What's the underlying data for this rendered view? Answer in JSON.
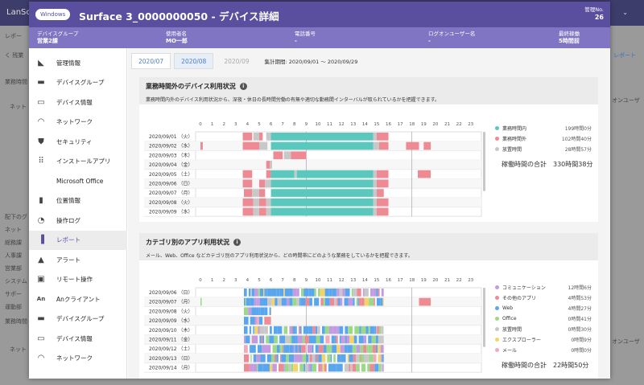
{
  "background": {
    "app_title": "LanSc",
    "left_labels": [
      "レポー",
      "く 残業",
      "業務時間",
      "ネット",
      "配下のグ",
      "ネット",
      "総務課",
      "人事課",
      "営業部",
      "システム",
      "サポー",
      "運動部",
      "業務時間",
      "ネット"
    ],
    "right_labels": [
      "レポート",
      "オンユーザ",
      "オンユーザ"
    ]
  },
  "modal": {
    "os_badge": "Windows",
    "title": "Surface 3_0000000050 - デバイス詳細",
    "mgmt_label": "管理No.",
    "mgmt_value": "26",
    "info": [
      {
        "label": "デバイスグループ",
        "value": "営業2課"
      },
      {
        "label": "使用者名",
        "value": "MO一郎"
      },
      {
        "label": "電話番号",
        "value": "-"
      },
      {
        "label": "ログオンユーザー名",
        "value": "-"
      },
      {
        "label": "最終稼働",
        "value": "5時間前"
      }
    ]
  },
  "sidebar": {
    "items": [
      {
        "label": "管理情報",
        "icon": "tag-icon"
      },
      {
        "label": "デバイスグループ",
        "icon": "folder-icon"
      },
      {
        "label": "デバイス情報",
        "icon": "device-icon"
      },
      {
        "label": "ネットワーク",
        "icon": "wifi-icon"
      },
      {
        "label": "セキュリティ",
        "icon": "shield-icon"
      },
      {
        "label": "インストールアプリ",
        "icon": "apps-grid-icon"
      },
      {
        "label": "Microsoft Office",
        "icon": "office-icon"
      },
      {
        "label": "位置情報",
        "icon": "map-icon"
      },
      {
        "label": "操作ログ",
        "icon": "history-icon"
      },
      {
        "label": "レポート",
        "icon": "bar-chart-icon",
        "active": true
      },
      {
        "label": "アラート",
        "icon": "warning-icon"
      },
      {
        "label": "リモート操作",
        "icon": "remote-icon"
      },
      {
        "label": "Anクライアント",
        "icon": "an-client-icon"
      },
      {
        "label": "デバイスグループ",
        "icon": "folder-icon"
      },
      {
        "label": "デバイス情報",
        "icon": "device-icon"
      },
      {
        "label": "ネットワーク",
        "icon": "wifi-icon"
      }
    ]
  },
  "tabs": {
    "items": [
      "2020/07",
      "2020/08",
      "2020/09"
    ],
    "selected": 1,
    "period": "集計期間: 2020/09/01 ～ 2020/09/29"
  },
  "card1": {
    "title": "業務時間外のデバイス利用状況",
    "desc": "業務時間内外のデバイス利用状況から、深夜・休日の長時間労働の有無や適切な勤務間インターバルが取られているかを把握できます。",
    "legend": [
      {
        "name": "業務時間内",
        "value": "199時間0分",
        "color": "#5bc8bd"
      },
      {
        "name": "業務時間外",
        "value": "102時間40分",
        "color": "#ee8a94"
      },
      {
        "name": "放置時間",
        "value": "28時間57分",
        "color": "#c8c8c8"
      }
    ],
    "total_label": "稼働時間の合計",
    "total_value": "330時間38分"
  },
  "card2": {
    "title": "カテゴリ別のアプリ利用状況",
    "desc": "メール、Web、Office などカテゴリ別のアプリ利用状況から、どの時間帯にどのような業務をしているかを把握できます。",
    "legend": [
      {
        "name": "コミュニケーション",
        "value": "12時間6分",
        "color": "#c39be0"
      },
      {
        "name": "その他のアプリ",
        "value": "4時間53分",
        "color": "#ee8a94"
      },
      {
        "name": "Web",
        "value": "4時間27分",
        "color": "#5aa6ee"
      },
      {
        "name": "Office",
        "value": "0時間41分",
        "color": "#9bd88a"
      },
      {
        "name": "放置時間",
        "value": "0時間30分",
        "color": "#c8c8c8"
      },
      {
        "name": "エクスプローラー",
        "value": "0時間9分",
        "color": "#f3d46a"
      },
      {
        "name": "メール",
        "value": "0時間0分",
        "color": "#f4a9b8"
      }
    ],
    "total_label": "稼働時間の合計",
    "total_value": "22時間50分"
  },
  "chart_data": [
    {
      "type": "timeline",
      "title": "業務時間外のデバイス利用状況",
      "hours": [
        "0",
        "1",
        "2",
        "3",
        "4",
        "5",
        "6",
        "7",
        "8",
        "9",
        "10",
        "11",
        "12",
        "13",
        "14",
        "15",
        "16",
        "17",
        "18",
        "19",
        "20",
        "21",
        "22",
        "23"
      ],
      "rows": [
        {
          "label": "2020/09/01 （火）",
          "segments": [
            [
              13.6,
              14.4,
              "out"
            ],
            [
              14.5,
              15.0,
              "idle"
            ],
            [
              15.0,
              15.3,
              "out"
            ],
            [
              15.6,
              16.0,
              "idle"
            ],
            [
              16.0,
              24.7,
              "in"
            ],
            [
              24.7,
              25.0,
              "idle"
            ],
            [
              25.0,
              26.0,
              "out"
            ]
          ]
        },
        {
          "label": "2020/09/02 （水）",
          "segments": [
            [
              10.0,
              10.2,
              "out"
            ],
            [
              13.6,
              15.0,
              "out"
            ],
            [
              15.0,
              15.7,
              "idle"
            ],
            [
              16.0,
              24.7,
              "in"
            ],
            [
              24.7,
              25.2,
              "idle"
            ],
            [
              25.2,
              26.0,
              "out"
            ],
            [
              27.5,
              28.6,
              "out"
            ],
            [
              29.0,
              29.6,
              "out"
            ]
          ]
        },
        {
          "label": "2020/09/03 （木）",
          "segments": [
            [
              16.2,
              17.0,
              "out"
            ],
            [
              17.1,
              17.7,
              "idle"
            ],
            [
              17.7,
              19.0,
              "out"
            ]
          ]
        },
        {
          "label": "2020/09/04 （金）",
          "segments": [
            [
              15.6,
              16.0,
              "out"
            ],
            [
              15.9,
              16.1,
              "idle"
            ]
          ]
        },
        {
          "label": "2020/09/05 （土）",
          "segments": [
            [
              13.6,
              14.4,
              "out"
            ],
            [
              15.6,
              16.0,
              "out"
            ],
            [
              16.0,
              18.0,
              "in"
            ],
            [
              18.0,
              18.2,
              "idle"
            ],
            [
              18.2,
              24.7,
              "in"
            ],
            [
              24.7,
              25.0,
              "idle"
            ],
            [
              25.0,
              26.0,
              "out"
            ],
            [
              28.5,
              29.6,
              "out"
            ]
          ]
        },
        {
          "label": "2020/09/06 （日）",
          "segments": [
            [
              13.6,
              14.4,
              "out"
            ],
            [
              15.0,
              15.5,
              "out"
            ],
            [
              15.5,
              16.0,
              "idle"
            ],
            [
              16.0,
              24.7,
              "in"
            ],
            [
              24.7,
              25.0,
              "idle"
            ],
            [
              25.0,
              26.0,
              "out"
            ]
          ]
        },
        {
          "label": "2020/09/07 （月）",
          "segments": [
            [
              13.7,
              14.4,
              "out"
            ],
            [
              14.4,
              15.0,
              "idle"
            ],
            [
              15.0,
              15.5,
              "out"
            ],
            [
              16.0,
              24.7,
              "in"
            ],
            [
              24.7,
              25.0,
              "idle"
            ],
            [
              25.0,
              25.6,
              "out"
            ]
          ]
        },
        {
          "label": "2020/09/08 （火）",
          "segments": [
            [
              13.6,
              14.5,
              "out"
            ],
            [
              14.5,
              15.0,
              "idle"
            ],
            [
              15.0,
              15.6,
              "out"
            ],
            [
              15.6,
              16.0,
              "idle"
            ],
            [
              16.0,
              24.7,
              "in"
            ],
            [
              24.7,
              25.0,
              "idle"
            ],
            [
              25.0,
              26.0,
              "out"
            ]
          ]
        },
        {
          "label": "2020/09/09 （水）",
          "segments": [
            [
              13.6,
              14.5,
              "out"
            ],
            [
              14.5,
              15.0,
              "idle"
            ],
            [
              15.0,
              15.6,
              "out"
            ],
            [
              15.6,
              16.0,
              "idle"
            ],
            [
              16.0,
              24.7,
              "in"
            ],
            [
              24.7,
              25.0,
              "idle"
            ],
            [
              25.0,
              26.0,
              "out"
            ]
          ]
        }
      ]
    },
    {
      "type": "timeline",
      "title": "カテゴリ別のアプリ利用状況",
      "hours": [
        "0",
        "1",
        "2",
        "3",
        "4",
        "5",
        "6",
        "7",
        "8",
        "9",
        "10",
        "11",
        "12",
        "13",
        "14",
        "15",
        "16",
        "17",
        "18",
        "19",
        "20",
        "21",
        "22",
        "23"
      ],
      "rows": [
        {
          "label": "2020/09/06 （日）"
        },
        {
          "label": "2020/09/07 （月）"
        },
        {
          "label": "2020/09/08 （火）"
        },
        {
          "label": "2020/09/09 （水）"
        },
        {
          "label": "2020/09/10 （木）"
        },
        {
          "label": "2020/09/11 （金）"
        },
        {
          "label": "2020/09/12 （土）"
        },
        {
          "label": "2020/09/13 （日）"
        },
        {
          "label": "2020/09/14 （月）"
        }
      ]
    }
  ]
}
